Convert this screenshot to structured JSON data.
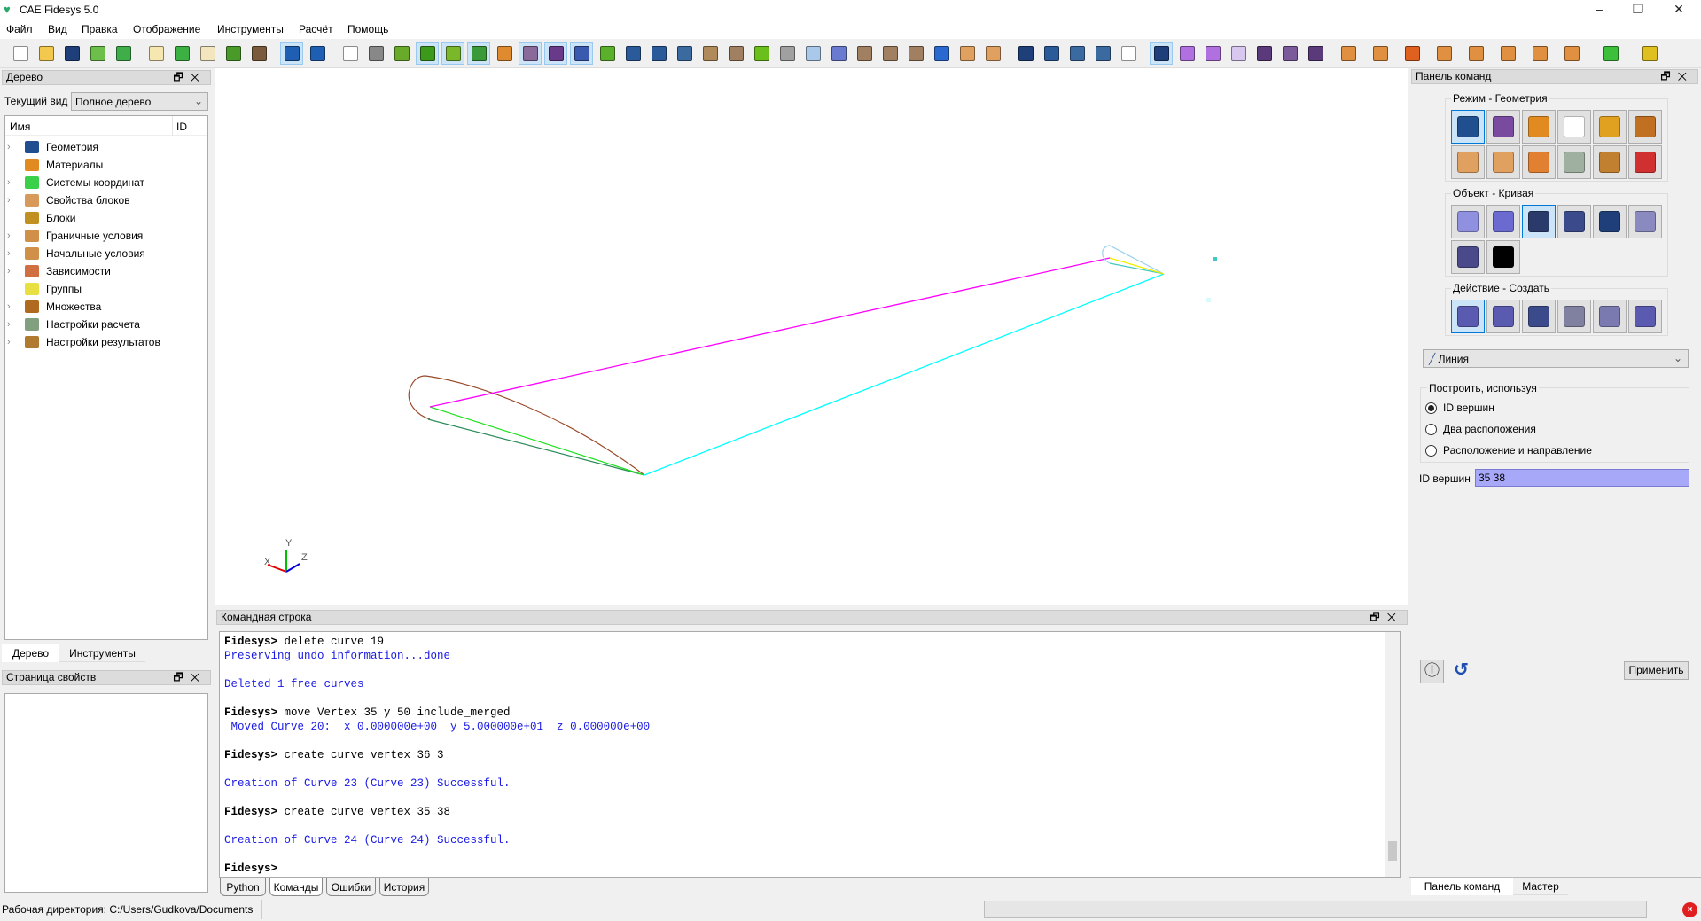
{
  "window": {
    "title": "CAE Fidesys 5.0",
    "minimize": "–",
    "maximize": "❐",
    "close": "✕"
  },
  "menu": [
    "Файл",
    "Вид",
    "Правка",
    "Отображение",
    "Инструменты",
    "Расчёт",
    "Помощь"
  ],
  "toolbar": [
    {
      "name": "new-file-icon",
      "color": "#ffffff"
    },
    {
      "name": "open-folder-icon",
      "color": "#f2c94c"
    },
    {
      "name": "save-icon",
      "color": "#1f3f7a"
    },
    {
      "name": "import-icon",
      "color": "#6cbf4a"
    },
    {
      "name": "export-icon",
      "color": "#3fae49"
    },
    {
      "name": "journal-edit-icon",
      "color": "#f6e7b0"
    },
    {
      "name": "play-journal-icon",
      "color": "#3cb043"
    },
    {
      "name": "play-id-icon",
      "color": "#f3e6bf"
    },
    {
      "name": "pause-icon",
      "color": "#4a9a2a"
    },
    {
      "name": "tools-hammer-icon",
      "color": "#7a5a3a"
    },
    {
      "name": "undo-power-icon",
      "color": "#1e5fb3",
      "on": true
    },
    {
      "name": "undo-icon",
      "color": "#1e5fb3"
    },
    {
      "name": "wireframe-cube-icon",
      "color": "#ffffff"
    },
    {
      "name": "hidden-cube-icon",
      "color": "#888888"
    },
    {
      "name": "shaded-cube-icon",
      "color": "#6aaa2a"
    },
    {
      "name": "solid-cube-icon",
      "color": "#3c9a1a",
      "on": true
    },
    {
      "name": "geometry-view-icon",
      "color": "#7ab82a",
      "on": true
    },
    {
      "name": "mesh-view-icon",
      "color": "#3a9a3a",
      "on": true
    },
    {
      "name": "materials-view-icon",
      "color": "#e08a30"
    },
    {
      "name": "grid-icon",
      "color": "#8a6a9a",
      "on": true
    },
    {
      "name": "purple-cube-icon",
      "color": "#6a3a8a",
      "on": true
    },
    {
      "name": "select-box-icon",
      "color": "#3a5ab0",
      "on": true
    },
    {
      "name": "refresh-icon",
      "color": "#5ab02a"
    },
    {
      "name": "zoom-in-icon",
      "color": "#2a5a9a"
    },
    {
      "name": "zoom-out-icon",
      "color": "#2a5a9a"
    },
    {
      "name": "fit-view-icon",
      "color": "#3a6aa0"
    },
    {
      "name": "box-icon",
      "color": "#b08a5a"
    },
    {
      "name": "ruler-view-icon",
      "color": "#a08060"
    },
    {
      "name": "green-frame-icon",
      "color": "#6abf1a"
    },
    {
      "name": "gray-frame-icon",
      "color": "#a0a0a0"
    },
    {
      "name": "transparent-cube-icon",
      "color": "#aac8ea"
    },
    {
      "name": "lens-icon",
      "color": "#6a7ad0"
    },
    {
      "name": "section-top-icon",
      "color": "#a08060"
    },
    {
      "name": "section-cross-icon",
      "color": "#a08060"
    },
    {
      "name": "section-corner-icon",
      "color": "#a08060"
    },
    {
      "name": "axes-icon",
      "color": "#2a6ad0"
    },
    {
      "name": "i-beam-icon",
      "color": "#e0a060"
    },
    {
      "name": "surface-icon",
      "color": "#e0a060"
    },
    {
      "name": "group-icon",
      "color": "#1f3f7a"
    },
    {
      "name": "volume-icon",
      "color": "#2a5a9a"
    },
    {
      "name": "body-icon",
      "color": "#3a6aa0"
    },
    {
      "name": "surface-select-icon",
      "color": "#3a6aa0"
    },
    {
      "name": "curve-select-icon",
      "color": "#ffffff"
    },
    {
      "name": "vertex-select-icon",
      "color": "#1f3f7a",
      "on": true
    },
    {
      "name": "node-icon",
      "color": "#b070e0"
    },
    {
      "name": "edge-icon",
      "color": "#b070e0"
    },
    {
      "name": "face-icon",
      "color": "#d8c8f0"
    },
    {
      "name": "hex-icon",
      "color": "#5a3a7a"
    },
    {
      "name": "mesh-grid-icon",
      "color": "#7a5a9a"
    },
    {
      "name": "element-cube-icon",
      "color": "#5a3a7a"
    },
    {
      "name": "force-icon",
      "color": "#e09040"
    },
    {
      "name": "pressure-icon",
      "color": "#e09040"
    },
    {
      "name": "heat-flux-icon",
      "color": "#e06020"
    },
    {
      "name": "displacement-icon",
      "color": "#e09040"
    },
    {
      "name": "temperature-icon",
      "color": "#e09040"
    },
    {
      "name": "convection-icon",
      "color": "#e09040"
    },
    {
      "name": "acceleration-icon",
      "color": "#e09040"
    },
    {
      "name": "constraint-icon",
      "color": "#e09040"
    },
    {
      "name": "run-icon",
      "color": "#3cc03c"
    },
    {
      "name": "view-axis-icon",
      "color": "#e0c020"
    }
  ],
  "tree_panel": {
    "title": "Дерево",
    "current_view_label": "Текущий вид",
    "current_view_value": "Полное дерево",
    "col_name": "Имя",
    "col_id": "ID",
    "items": [
      {
        "label": "Геометрия",
        "expandable": true,
        "color": "#1f4f8f"
      },
      {
        "label": "Материалы",
        "expandable": false,
        "color": "#e08a20"
      },
      {
        "label": "Системы координат",
        "expandable": true,
        "color": "#3ad04a"
      },
      {
        "label": "Свойства блоков",
        "expandable": true,
        "color": "#d89a5a"
      },
      {
        "label": "Блоки",
        "expandable": false,
        "color": "#c09020"
      },
      {
        "label": "Граничные условия",
        "expandable": true,
        "color": "#d0904a"
      },
      {
        "label": "Начальные условия",
        "expandable": true,
        "color": "#d0904a"
      },
      {
        "label": "Зависимости",
        "expandable": true,
        "color": "#d07040"
      },
      {
        "label": "Группы",
        "expandable": false,
        "color": "#e8e040"
      },
      {
        "label": "Множества",
        "expandable": true,
        "color": "#b06a20"
      },
      {
        "label": "Настройки расчета",
        "expandable": true,
        "color": "#80a080"
      },
      {
        "label": "Настройки результатов",
        "expandable": true,
        "color": "#b07a30"
      }
    ],
    "tabs": [
      "Дерево",
      "Инструменты"
    ]
  },
  "properties_panel": {
    "title": "Страница свойств"
  },
  "viewport": {
    "axes": {
      "x": "X",
      "y": "Y",
      "z": "Z"
    }
  },
  "command_line": {
    "title": "Командная строка",
    "lines": [
      {
        "type": "prompt",
        "prompt": "Fidesys>",
        "text": " delete curve 19"
      },
      {
        "type": "output",
        "text": "Preserving undo information...done"
      },
      {
        "type": "blank",
        "text": ""
      },
      {
        "type": "output",
        "text": "Deleted 1 free curves"
      },
      {
        "type": "blank",
        "text": ""
      },
      {
        "type": "prompt",
        "prompt": "Fidesys>",
        "text": " move Vertex 35 y 50 include_merged"
      },
      {
        "type": "output",
        "text": " Moved Curve 20:  x 0.000000e+00  y 5.000000e+01  z 0.000000e+00"
      },
      {
        "type": "blank",
        "text": ""
      },
      {
        "type": "prompt",
        "prompt": "Fidesys>",
        "text": " create curve vertex 36 3"
      },
      {
        "type": "blank",
        "text": ""
      },
      {
        "type": "output",
        "text": "Creation of Curve 23 (Curve 23) Successful."
      },
      {
        "type": "blank",
        "text": ""
      },
      {
        "type": "prompt",
        "prompt": "Fidesys>",
        "text": " create curve vertex 35 38"
      },
      {
        "type": "blank",
        "text": ""
      },
      {
        "type": "output",
        "text": "Creation of Curve 24 (Curve 24) Successful."
      },
      {
        "type": "blank",
        "text": ""
      },
      {
        "type": "prompt",
        "prompt": "Fidesys>",
        "text": ""
      }
    ],
    "tabs": [
      "Python",
      "Команды",
      "Ошибки",
      "История"
    ],
    "active_tab": "Команды"
  },
  "command_panel": {
    "title": "Панель команд",
    "mode_group": "Режим - Геометрия",
    "mode_buttons": [
      {
        "name": "geometry-mode-icon",
        "color": "#1f4f8f",
        "on": true
      },
      {
        "name": "mesh-mode-icon",
        "color": "#7a4aa0"
      },
      {
        "name": "materials-mode-icon",
        "color": "#e08a20"
      },
      {
        "name": "coordinate-systems-mode-icon",
        "color": "#ffffff"
      },
      {
        "name": "blocks-mode-icon",
        "color": "#e0a020"
      },
      {
        "name": "sets-mode-icon",
        "color": "#c07020"
      },
      {
        "name": "boundary-conditions-mode-icon",
        "color": "#e0a060"
      },
      {
        "name": "initial-conditions-mode-icon",
        "color": "#e0a060"
      },
      {
        "name": "dependencies-mode-icon",
        "color": "#e08030"
      },
      {
        "name": "analysis-settings-mode-icon",
        "color": "#a0b0a0"
      },
      {
        "name": "results-settings-mode-icon",
        "color": "#c08030"
      },
      {
        "name": "inspect-mode-icon",
        "color": "#d03030"
      }
    ],
    "object_group": "Объект - Кривая",
    "object_buttons": [
      {
        "name": "volume-object-icon",
        "color": "#9090e0"
      },
      {
        "name": "surface-object-icon",
        "color": "#6a6ad0"
      },
      {
        "name": "curve-object-icon",
        "color": "#2a3a6a",
        "on": true
      },
      {
        "name": "vertex-object-icon",
        "color": "#3a4a8a"
      },
      {
        "name": "group-object-icon",
        "color": "#1f3f7a"
      },
      {
        "name": "body-object-icon",
        "color": "#8a8ac0"
      },
      {
        "name": "measure-object-icon",
        "color": "#4a4a8a"
      },
      {
        "name": "label-object-icon",
        "color": "#000000"
      }
    ],
    "action_group": "Действие - Создать",
    "action_buttons": [
      {
        "name": "create-action-icon",
        "color": "#5a5ab0",
        "on": true
      },
      {
        "name": "modify-action-icon",
        "color": "#5a5ab0"
      },
      {
        "name": "transform-action-icon",
        "color": "#3a4a8a"
      },
      {
        "name": "properties-action-icon",
        "color": "#8080a0"
      },
      {
        "name": "delete-action-icon",
        "color": "#7a7ab0"
      },
      {
        "name": "copy-action-icon",
        "color": "#5a5ab0"
      }
    ],
    "type_select": "Линия",
    "build_group": "Построить, используя",
    "radios": [
      {
        "label": "ID вершин",
        "checked": true
      },
      {
        "label": "Два расположения",
        "checked": false
      },
      {
        "label": "Расположение и направление",
        "checked": false
      }
    ],
    "vertex_id_label": "ID вершин",
    "vertex_id_value": "35 38",
    "apply": "Применить",
    "tabs": [
      "Панель команд",
      "Мастер"
    ]
  },
  "status": {
    "working_dir": "Рабочая директория: C:/Users/Gudkova/Documents"
  }
}
